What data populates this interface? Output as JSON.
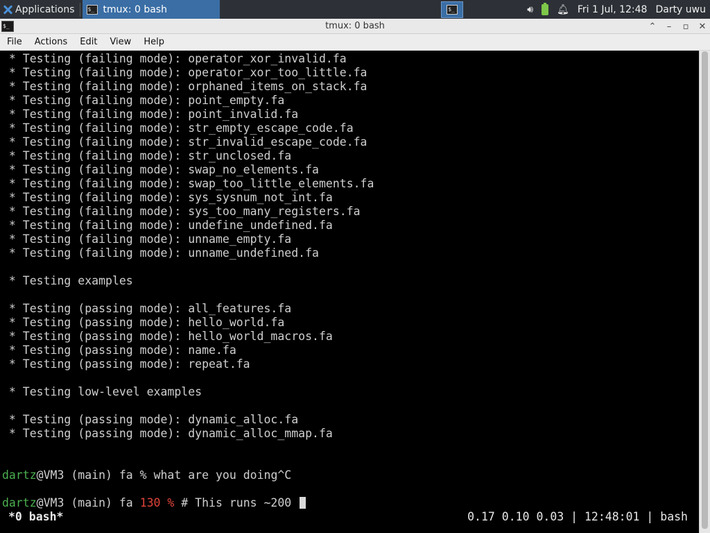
{
  "panel": {
    "applications_label": "Applications",
    "task_label": "tmux: 0 bash",
    "clock": "Fri  1 Jul, 12:48",
    "user": "Darty uwu"
  },
  "window": {
    "title": "tmux: 0 bash",
    "minimize_glyph": "⌃",
    "restore_glyph": "–",
    "maximize_glyph": "▫",
    "close_glyph": "✕"
  },
  "menu": {
    "file": "File",
    "actions": "Actions",
    "edit": "Edit",
    "view": "View",
    "help": "Help"
  },
  "terminal": {
    "lines": [
      " * Testing (failing mode): operator_xor_invalid.fa",
      " * Testing (failing mode): operator_xor_too_little.fa",
      " * Testing (failing mode): orphaned_items_on_stack.fa",
      " * Testing (failing mode): point_empty.fa",
      " * Testing (failing mode): point_invalid.fa",
      " * Testing (failing mode): str_empty_escape_code.fa",
      " * Testing (failing mode): str_invalid_escape_code.fa",
      " * Testing (failing mode): str_unclosed.fa",
      " * Testing (failing mode): swap_no_elements.fa",
      " * Testing (failing mode): swap_too_little_elements.fa",
      " * Testing (failing mode): sys_sysnum_not_int.fa",
      " * Testing (failing mode): sys_too_many_registers.fa",
      " * Testing (failing mode): undefine_undefined.fa",
      " * Testing (failing mode): unname_empty.fa",
      " * Testing (failing mode): unname_undefined.fa",
      "",
      " * Testing examples",
      "",
      " * Testing (passing mode): all_features.fa",
      " * Testing (passing mode): hello_world.fa",
      " * Testing (passing mode): hello_world_macros.fa",
      " * Testing (passing mode): name.fa",
      " * Testing (passing mode): repeat.fa",
      "",
      " * Testing low-level examples",
      "",
      " * Testing (passing mode): dynamic_alloc.fa",
      " * Testing (passing mode): dynamic_alloc_mmap.fa"
    ],
    "prompt1": {
      "user": "dartz",
      "host": "@VM3 (main) fa % ",
      "text": "what are you doing^C"
    },
    "prompt2": {
      "user": "dartz",
      "host": "@VM3 (main) fa ",
      "code": "130 %",
      "text": " # This runs ~200 "
    }
  },
  "tmux": {
    "window_label": "*0 bash*",
    "status_right": "0.17 0.10 0.03 | 12:48:01 | bash"
  }
}
